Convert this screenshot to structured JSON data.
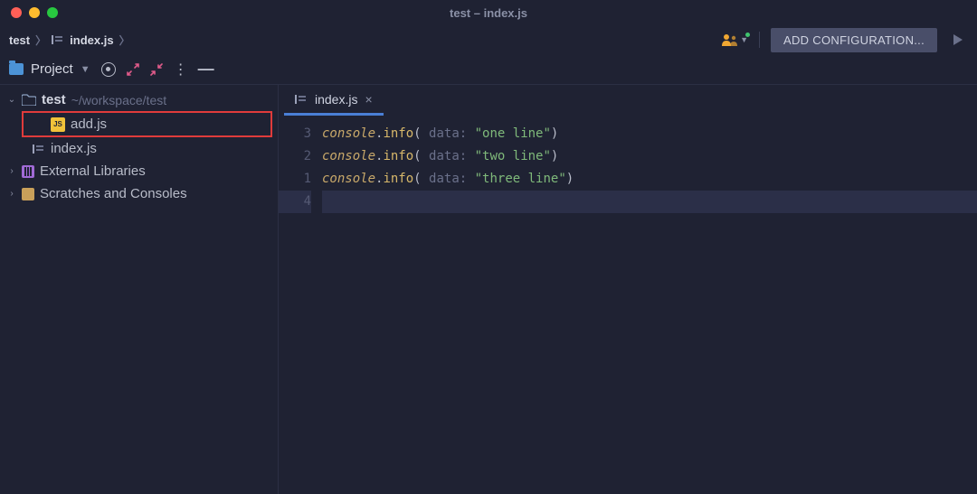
{
  "window": {
    "title": "test – index.js"
  },
  "breadcrumb": {
    "project": "test",
    "file": "index.js"
  },
  "toolbar": {
    "project_label": "Project",
    "add_config": "ADD CONFIGURATION..."
  },
  "tree": {
    "root": "test",
    "root_path": "~/workspace/test",
    "files": [
      {
        "name": "add.js"
      },
      {
        "name": "index.js"
      }
    ],
    "external": "External Libraries",
    "scratches": "Scratches and Consoles"
  },
  "tab": {
    "name": "index.js"
  },
  "code": {
    "gutter": [
      "3",
      "2",
      "1",
      "4"
    ],
    "lines": [
      {
        "obj": "console",
        "fn": "info",
        "hint": "data:",
        "str": "\"one line\""
      },
      {
        "obj": "console",
        "fn": "info",
        "hint": "data:",
        "str": "\"two line\""
      },
      {
        "obj": "console",
        "fn": "info",
        "hint": "data:",
        "str": "\"three line\""
      }
    ]
  }
}
